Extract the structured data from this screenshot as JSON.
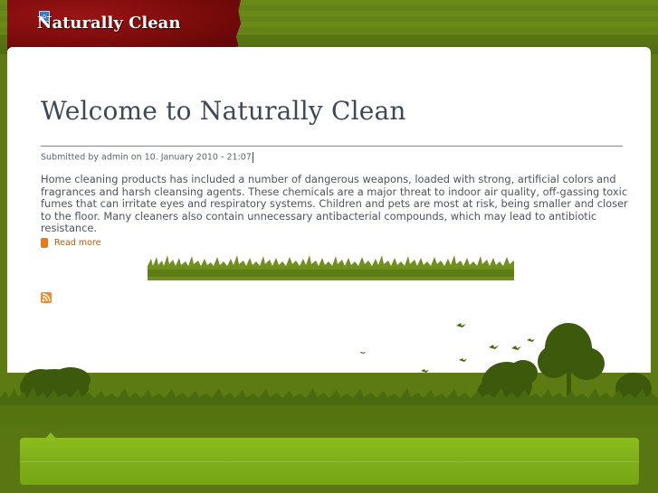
{
  "header": {
    "site_name": "Naturally Clean",
    "logo_icon": "site-logo-icon",
    "banner_color": "#7a0b0b"
  },
  "article": {
    "title": "Welcome to Naturally Clean",
    "submitted": "Submitted by admin on 10. January 2010 - 21:07",
    "body": "Home cleaning products has included a number of dangerous weapons, loaded with strong, artificial colors and fragrances and harsh cleansing agents. These chemicals are a major threat to indoor air quality, off-gassing toxic fumes that can irritate eyes and respiratory systems. Children and pets are most at risk, being smaller and closer to the floor. Many cleaners also contain unnecessary antibacterial compounds, which may lead to antibiotic resistance.",
    "read_more": "Read more"
  },
  "feed": {
    "icon": "rss-icon"
  },
  "colors": {
    "accent_green": "#7c9a2a",
    "background_green": "#5e7a12",
    "footer_green": "#8cbd1e",
    "link_orange": "#b85a10"
  }
}
